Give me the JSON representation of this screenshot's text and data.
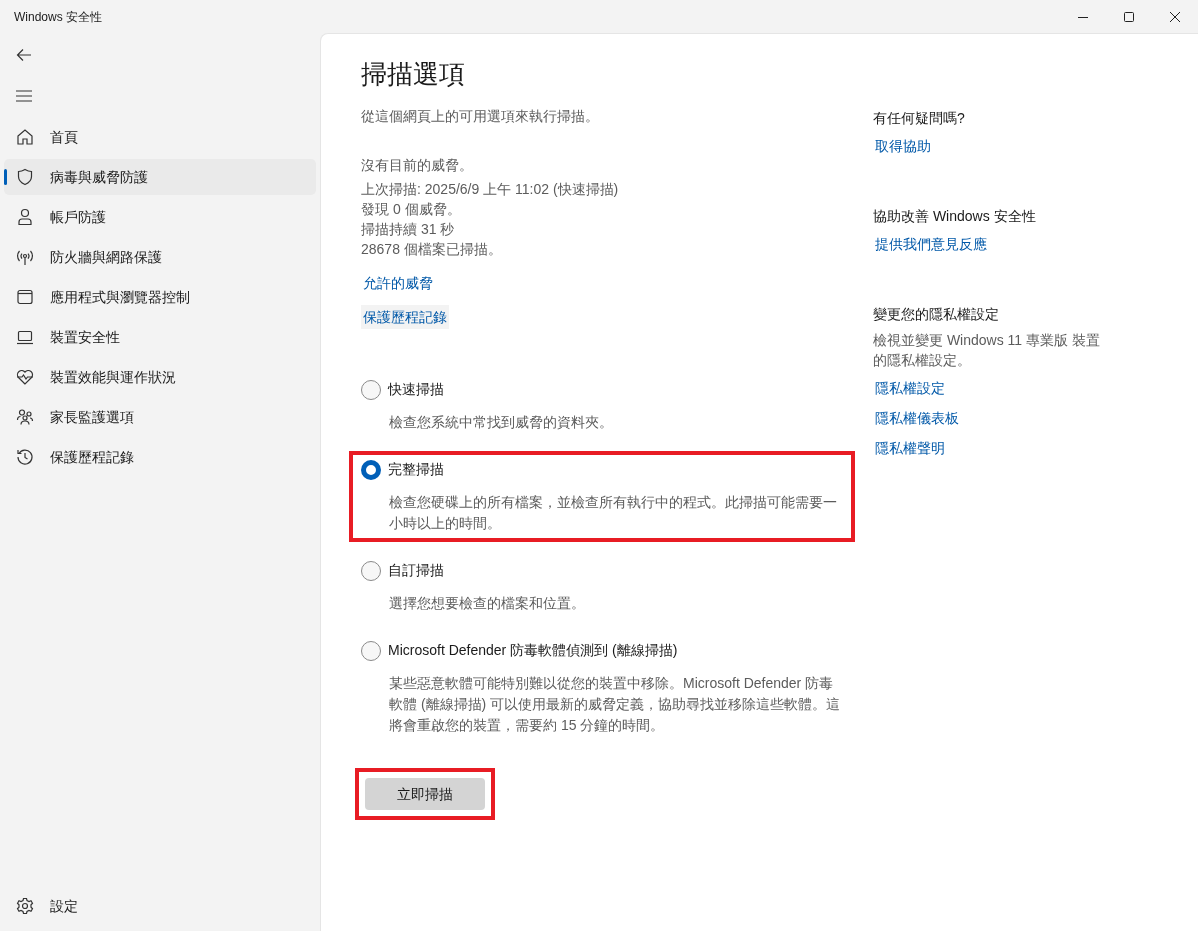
{
  "window": {
    "title": "Windows 安全性"
  },
  "sidebar": {
    "items": [
      {
        "kind": "home",
        "label": "首頁",
        "selected": false
      },
      {
        "kind": "shield",
        "label": "病毒與威脅防護",
        "selected": true
      },
      {
        "kind": "person",
        "label": "帳戶防護",
        "selected": false
      },
      {
        "kind": "antenna",
        "label": "防火牆與網路保護",
        "selected": false
      },
      {
        "kind": "window",
        "label": "應用程式與瀏覽器控制",
        "selected": false
      },
      {
        "kind": "laptop",
        "label": "裝置安全性",
        "selected": false
      },
      {
        "kind": "heart",
        "label": "裝置效能與運作狀況",
        "selected": false
      },
      {
        "kind": "family",
        "label": "家長監護選項",
        "selected": false
      },
      {
        "kind": "history",
        "label": "保護歷程記錄",
        "selected": false
      }
    ],
    "settings": {
      "label": "設定"
    }
  },
  "main": {
    "title": "掃描選項",
    "subtitle": "從這個網頁上的可用選項來執行掃描。",
    "status": [
      "沒有目前的威脅。",
      "上次掃描: 2025/6/9 上午 11:02 (快速掃描)",
      "發現 0 個威脅。",
      "掃描持續 31 秒",
      "28678 個檔案已掃描。"
    ],
    "links": [
      {
        "label": "允許的威脅",
        "hovered": false
      },
      {
        "label": "保護歷程記錄",
        "hovered": true
      }
    ],
    "options": [
      {
        "label": "快速掃描",
        "description": "檢查您系統中常找到威脅的資料夾。",
        "selected": false,
        "highlighted": false
      },
      {
        "label": "完整掃描",
        "description": "檢查您硬碟上的所有檔案，並檢查所有執行中的程式。此掃描可能需要一小時以上的時間。",
        "selected": true,
        "highlighted": true
      },
      {
        "label": "自訂掃描",
        "description": "選擇您想要檢查的檔案和位置。",
        "selected": false,
        "highlighted": false
      },
      {
        "label": "Microsoft Defender 防毒軟體偵測到 (離線掃描)",
        "description": "某些惡意軟體可能特別難以從您的裝置中移除。Microsoft Defender 防毒軟體 (離線掃描) 可以使用最新的威脅定義，協助尋找並移除這些軟體。這將會重啟您的裝置，需要約 15 分鐘的時間。",
        "selected": false,
        "highlighted": false
      }
    ],
    "button": {
      "label": "立即掃描",
      "highlighted": true
    }
  },
  "aside": [
    {
      "heading": "有任何疑問嗎?",
      "links": [
        "取得協助"
      ]
    },
    {
      "heading": "協助改善 Windows 安全性",
      "links": [
        "提供我們意見反應"
      ]
    },
    {
      "heading": "變更您的隱私權設定",
      "text": "檢視並變更 Windows 11 專業版 裝置的隱私權設定。",
      "links": [
        "隱私權設定",
        "隱私權儀表板",
        "隱私權聲明"
      ]
    }
  ]
}
